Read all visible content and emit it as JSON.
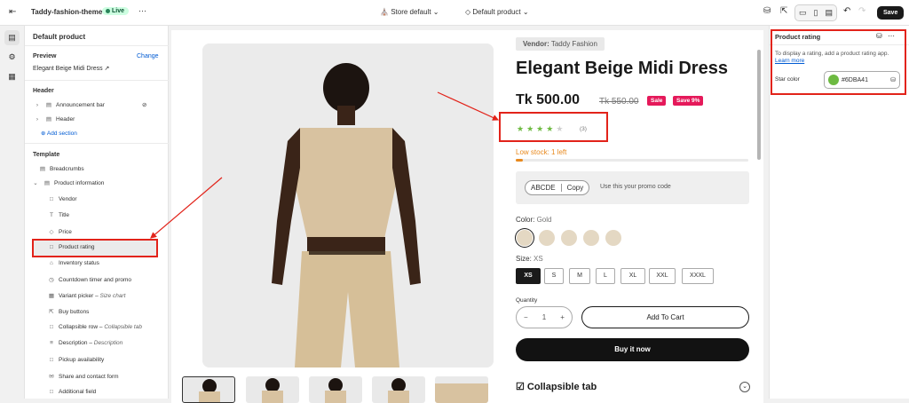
{
  "topbar": {
    "theme": "Taddy-fashion-theme",
    "live": "Live",
    "more": "⋯",
    "store": "Store default",
    "product": "Default product",
    "save": "Save"
  },
  "sidebar": {
    "title": "Default product",
    "preview_label": "Preview",
    "change": "Change",
    "preview_value": "Elegant Beige Midi Dress",
    "header_section": "Header",
    "header_items": [
      "Announcement bar",
      "Header"
    ],
    "add_section": "Add section",
    "template_section": "Template",
    "template_items": [
      {
        "label": "Breadcrumbs",
        "sub": ""
      },
      {
        "label": "Product information",
        "sub": ""
      },
      {
        "label": "Vendor",
        "sub": ""
      },
      {
        "label": "Title",
        "sub": ""
      },
      {
        "label": "Price",
        "sub": ""
      },
      {
        "label": "Product rating",
        "sub": ""
      },
      {
        "label": "Inventory status",
        "sub": ""
      },
      {
        "label": "Countdown timer and promo",
        "sub": ""
      },
      {
        "label": "Variant picker",
        "sub": "Size chart"
      },
      {
        "label": "Buy buttons",
        "sub": ""
      },
      {
        "label": "Collapsible row",
        "sub": "Collapsible tab"
      },
      {
        "label": "Description",
        "sub": "Description"
      },
      {
        "label": "Pickup availability",
        "sub": ""
      },
      {
        "label": "Share and contact form",
        "sub": ""
      },
      {
        "label": "Additional field",
        "sub": ""
      }
    ]
  },
  "product": {
    "vendor_label": "Vendor:",
    "vendor": "Taddy Fashion",
    "title": "Elegant Beige Midi Dress",
    "price": "Tk 500.00",
    "old_price": "Tk 550.00",
    "badge_sale": "Sale",
    "badge_save": "Save 9%",
    "rating": 4,
    "rating_max": 5,
    "review_count": "(3)",
    "low_stock": "Low stock: 1 left",
    "stock_level": 0.03,
    "promo_code": "ABCDE",
    "copy": "Copy",
    "promo_text": "Use this your promo code",
    "color_label": "Color:",
    "color_value": "Gold",
    "size_label": "Size:",
    "size_value": "XS",
    "sizes": [
      "XS",
      "S",
      "M",
      "L",
      "XL",
      "XXL",
      "XXXL"
    ],
    "quantity_label": "Quantity",
    "quantity": "1",
    "add_to_cart": "Add To Cart",
    "buy_now": "Buy it now",
    "collapsible": "Collapsible tab"
  },
  "right_panel": {
    "title": "Product rating",
    "info": "To display a rating, add a product rating app.",
    "learn_more": "Learn more",
    "star_color_label": "Star color",
    "star_color": "#6DBA41"
  },
  "colors": {
    "accent": "#6DBA41",
    "sale": "#E5195A",
    "annotation": "#E2231A",
    "link": "#005BD3"
  }
}
